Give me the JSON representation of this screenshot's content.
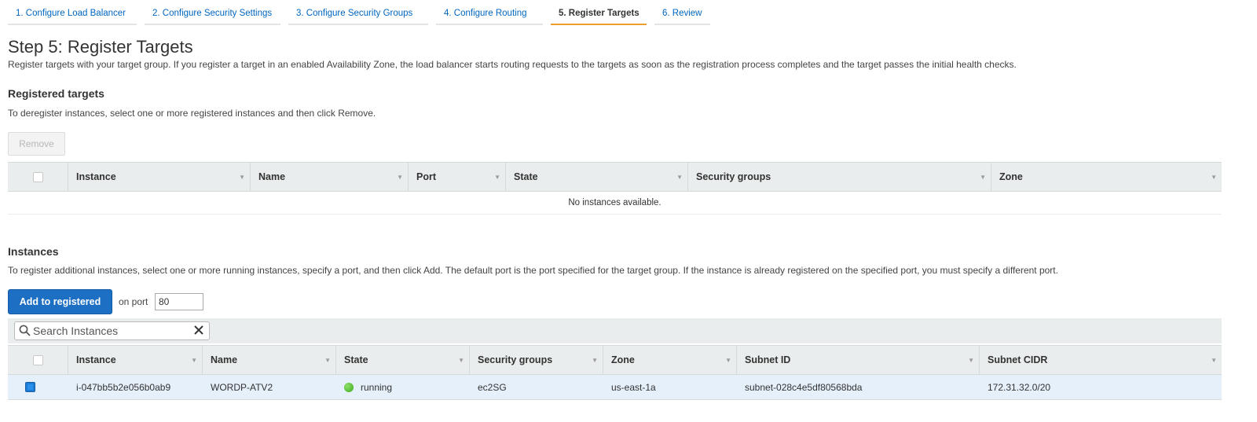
{
  "wizard": {
    "tabs": [
      {
        "label": "1. Configure Load Balancer"
      },
      {
        "label": "2. Configure Security Settings"
      },
      {
        "label": "3. Configure Security Groups"
      },
      {
        "label": "4. Configure Routing"
      },
      {
        "label": "5. Register Targets",
        "active": true
      },
      {
        "label": "6. Review"
      }
    ]
  },
  "step": {
    "title": "Step 5: Register Targets",
    "description": "Register targets with your target group. If you register a target in an enabled Availability Zone, the load balancer starts routing requests to the targets as soon as the registration process completes and the target passes the initial health checks."
  },
  "registered": {
    "heading": "Registered targets",
    "description": "To deregister instances, select one or more registered instances and then click Remove.",
    "remove_label": "Remove",
    "columns": [
      "Instance",
      "Name",
      "Port",
      "State",
      "Security groups",
      "Zone"
    ],
    "empty_message": "No instances available."
  },
  "instances": {
    "heading": "Instances",
    "description": "To register additional instances, select one or more running instances, specify a port, and then click Add. The default port is the port specified for the target group. If the instance is already registered on the specified port, you must specify a different port.",
    "add_label": "Add to registered",
    "on_port_label": "on port",
    "port_value": "80",
    "search_placeholder": "Search Instances",
    "columns": [
      "Instance",
      "Name",
      "State",
      "Security groups",
      "Zone",
      "Subnet ID",
      "Subnet CIDR"
    ],
    "rows": [
      {
        "selected": true,
        "instance": "i-047bb5b2e056b0ab9",
        "name": "WORDP-ATV2",
        "state": "running",
        "security_groups": "ec2SG",
        "zone": "us-east-1a",
        "subnet_id": "subnet-028c4e5df80568bda",
        "subnet_cidr": "172.31.32.0/20"
      }
    ]
  },
  "colors": {
    "accent_tab": "#eb9e2d",
    "primary_button": "#1d6fc4",
    "link": "#0066c0",
    "running": "#3aa61b"
  }
}
